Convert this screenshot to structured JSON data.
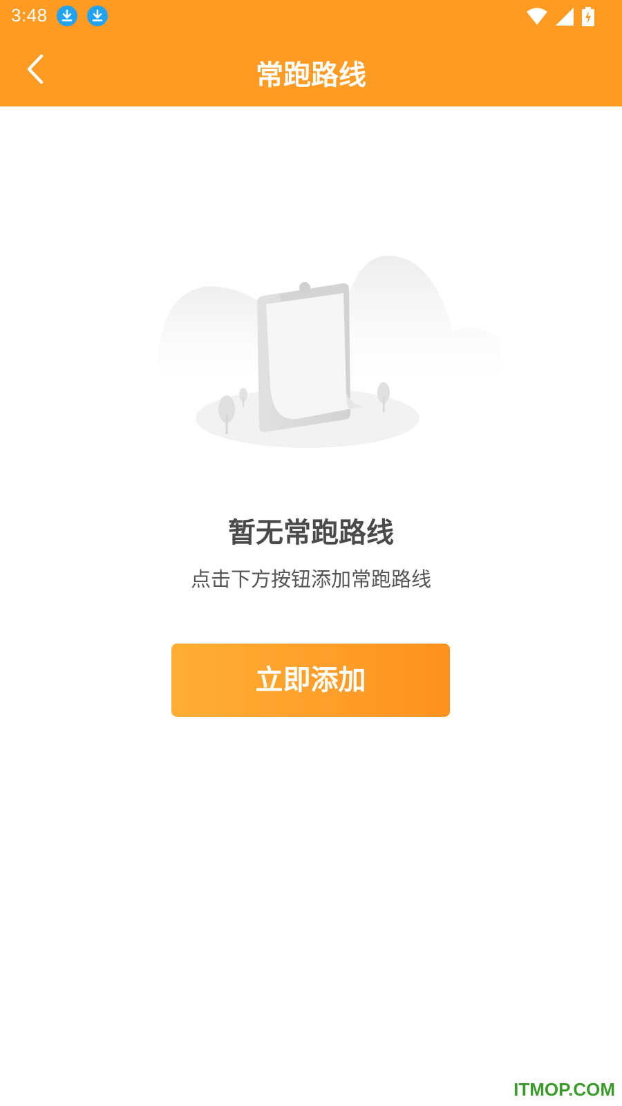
{
  "status_bar": {
    "time": "3:48",
    "icons": [
      "download-icon",
      "download-icon",
      "wifi-icon",
      "cellular-signal-icon",
      "battery-charging-icon"
    ]
  },
  "header": {
    "title": "常跑路线",
    "back_icon": "chevron-left-icon"
  },
  "empty_state": {
    "illustration": "empty-clipboard-illustration",
    "title": "暂无常跑路线",
    "subtitle": "点击下方按钮添加常跑路线",
    "button_label": "立即添加"
  },
  "watermark": "ITMOP.COM",
  "colors": {
    "primary": "#FF9A22",
    "button_gradient_start": "#FFAE35",
    "button_gradient_end": "#FF9220",
    "download_icon_bg": "#1FA3F2",
    "title_text": "#4a4a4a",
    "watermark": "#3a9b2a"
  }
}
